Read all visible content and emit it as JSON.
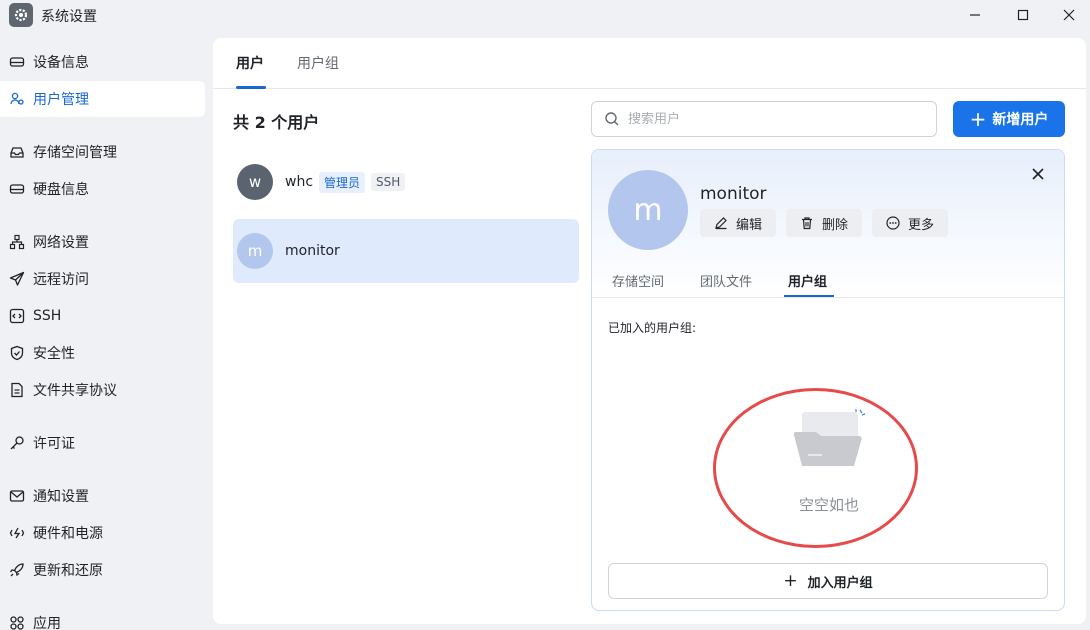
{
  "window": {
    "title": "系统设置",
    "controls": [
      "minimize-icon",
      "maximize-icon",
      "close-icon"
    ]
  },
  "sidebar": {
    "items": [
      {
        "label": "设备信息",
        "icon": "harddrive-icon"
      },
      {
        "label": "用户管理",
        "icon": "users-icon",
        "active": true
      },
      {
        "label": "存储空间管理",
        "icon": "inbox-icon"
      },
      {
        "label": "硬盘信息",
        "icon": "disk-icon"
      },
      {
        "label": "网络设置",
        "icon": "network-icon"
      },
      {
        "label": "远程访问",
        "icon": "send-icon"
      },
      {
        "label": "SSH",
        "icon": "code-icon"
      },
      {
        "label": "安全性",
        "icon": "shield-icon"
      },
      {
        "label": "文件共享协议",
        "icon": "file-icon"
      },
      {
        "label": "许可证",
        "icon": "key-icon"
      },
      {
        "label": "通知设置",
        "icon": "mail-icon"
      },
      {
        "label": "硬件和电源",
        "icon": "power-icon"
      },
      {
        "label": "更新和还原",
        "icon": "rocket-icon"
      },
      {
        "label": "应用",
        "icon": "apps-icon"
      }
    ]
  },
  "main": {
    "tabs": [
      {
        "label": "用户",
        "active": true
      },
      {
        "label": "用户组"
      }
    ],
    "count_title": "共 2 个用户",
    "search": {
      "placeholder": "搜索用户"
    },
    "add_button": "新增用户",
    "users": [
      {
        "initial": "w",
        "name": "whc",
        "tags": [
          "管理员",
          "SSH"
        ],
        "avatar_color": "#5b6270"
      },
      {
        "initial": "m",
        "name": "monitor",
        "tags": [],
        "avatar_color": "#b3c6ee",
        "selected": true
      }
    ]
  },
  "detail": {
    "initial": "m",
    "name": "monitor",
    "actions": {
      "edit": "编辑",
      "delete": "删除",
      "more": "更多"
    },
    "tabs": [
      {
        "label": "存储空间"
      },
      {
        "label": "团队文件"
      },
      {
        "label": "用户组",
        "active": true
      }
    ],
    "joined_label": "已加入的用户组:",
    "empty_text": "空空如也",
    "join_button": "加入用户组"
  },
  "colors": {
    "accent": "#1a73e8",
    "selected_bg": "#dfeafc",
    "annotation_red": "#e54b4b"
  }
}
